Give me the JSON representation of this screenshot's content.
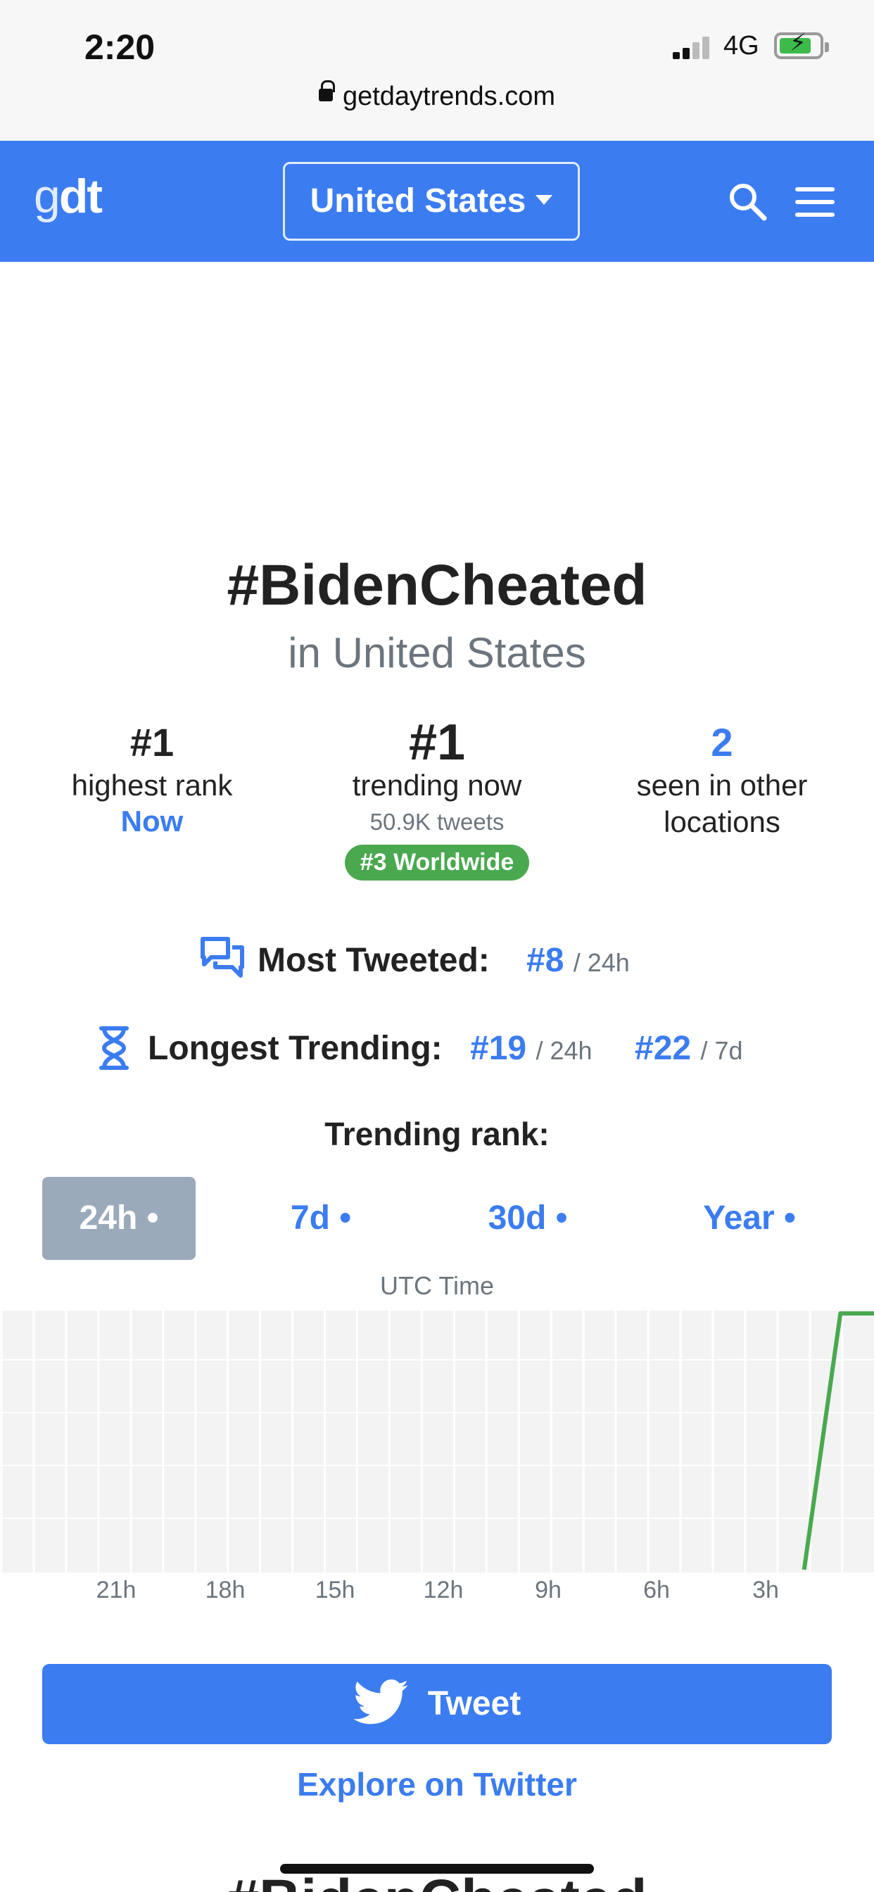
{
  "status_bar": {
    "time": "2:20",
    "network": "4G",
    "url": "getdaytrends.com"
  },
  "navbar": {
    "logo_g": "g",
    "logo_dt": "dt",
    "country": "United States",
    "icons": [
      "search-icon",
      "menu-icon"
    ],
    "accent": "#3b7cf0"
  },
  "trend": {
    "title": "#BidenCheated",
    "location": "in United States"
  },
  "stats": {
    "highest": {
      "value": "#1",
      "label": "highest rank",
      "when": "Now"
    },
    "current": {
      "value": "#1",
      "label": "trending now",
      "tweets": "50.9K tweets",
      "worldwide": "#3 Worldwide"
    },
    "other": {
      "value": "2",
      "label_line1": "seen in other",
      "label_line2": "locations"
    }
  },
  "most_tweeted": {
    "label": "Most Tweeted:",
    "rank": "#8",
    "period": "/ 24h"
  },
  "longest_trending": {
    "label": "Longest Trending:",
    "rank_24h": "#19",
    "period_24h": "/ 24h",
    "rank_7d": "#22",
    "period_7d": "/ 7d"
  },
  "trending_rank": {
    "label": "Trending rank:",
    "tabs": [
      {
        "label": "24h •",
        "active": true
      },
      {
        "label": "7d •",
        "active": false
      },
      {
        "label": "30d •",
        "active": false
      },
      {
        "label": "Year •",
        "active": false
      }
    ],
    "axis_title": "UTC Time"
  },
  "chart_data": {
    "type": "line",
    "title": "",
    "xlabel": "UTC Time",
    "ylabel": "",
    "x_ticks": [
      "21h",
      "18h",
      "15h",
      "12h",
      "9h",
      "6h",
      "3h"
    ],
    "xlim_hours_ago": [
      24,
      0
    ],
    "ylim_rank": [
      1,
      50
    ],
    "series": [
      {
        "color": "#4aa84f",
        "points": [
          [
            2,
            50
          ],
          [
            1,
            1
          ],
          [
            0,
            1
          ]
        ]
      }
    ],
    "grid": true
  },
  "actions": {
    "tweet": "Tweet",
    "explore": "Explore on Twitter"
  },
  "footer_title": "#BidenCheated"
}
